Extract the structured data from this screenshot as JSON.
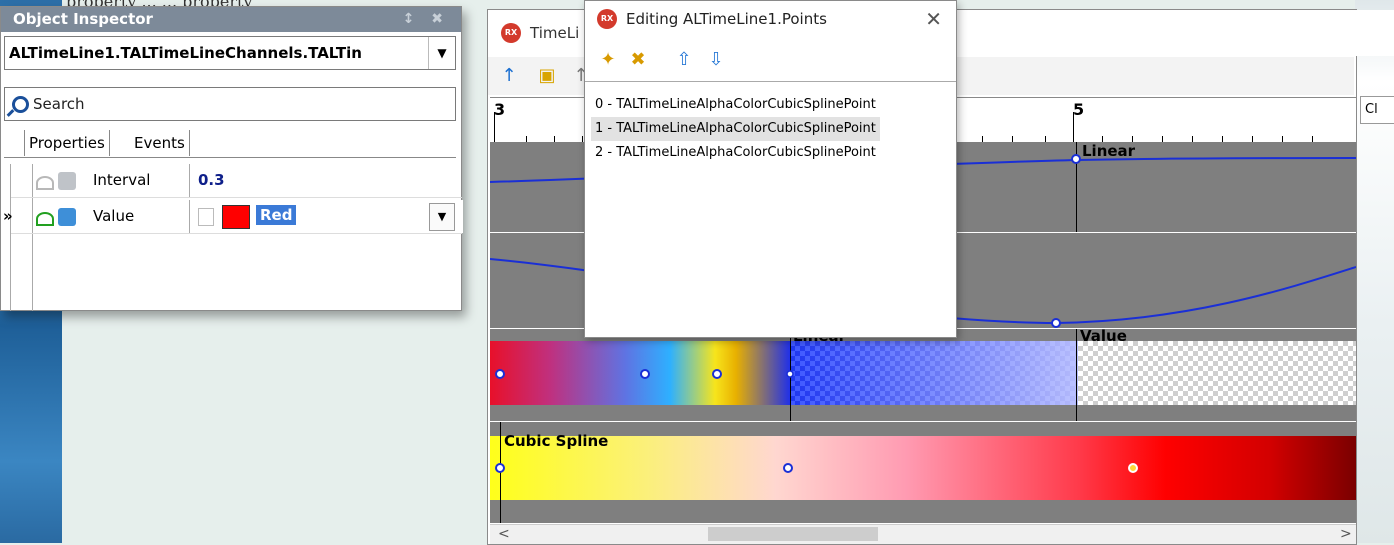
{
  "background": {
    "text": "property ... ... property"
  },
  "object_inspector": {
    "title": "Object Inspector",
    "title_tools": "↕ ✖",
    "component_selector": "ALTimeLine1.TALTimeLineChannels.TALTin",
    "search_placeholder": "Search",
    "tabs": [
      "Properties",
      "Events"
    ],
    "properties": [
      {
        "name": "Interval",
        "value": "0.3"
      },
      {
        "name": "Value",
        "value": "Red",
        "color": "#ff0000"
      }
    ],
    "current_row_marker": "»"
  },
  "timeline_window": {
    "title": "TimeLi",
    "ruler_labels": [
      "3",
      "5"
    ],
    "tracks": [
      {
        "label": "Linear"
      },
      {
        "label": ""
      },
      {
        "labels": [
          "Linear",
          "Value"
        ]
      },
      {
        "label": "Cubic Spline"
      }
    ],
    "side_tab": "Cl",
    "scroll_left": "<",
    "scroll_right": ">"
  },
  "editing_dialog": {
    "title": "Editing ALTimeLine1.Points",
    "close_label": "✕",
    "items": [
      "0 - TALTimeLineAlphaColorCubicSplinePoint",
      "1 - TALTimeLineAlphaColorCubicSplinePoint",
      "2 - TALTimeLineAlphaColorCubicSplinePoint"
    ],
    "selected_index": 1
  },
  "colors": {
    "inspector_title_bg": "#7d8a99",
    "selection_blue": "#3b7ad7",
    "track_gray": "#7f7f7f",
    "curve_blue": "#1a2fd6",
    "rx_red": "#d33a2c"
  }
}
